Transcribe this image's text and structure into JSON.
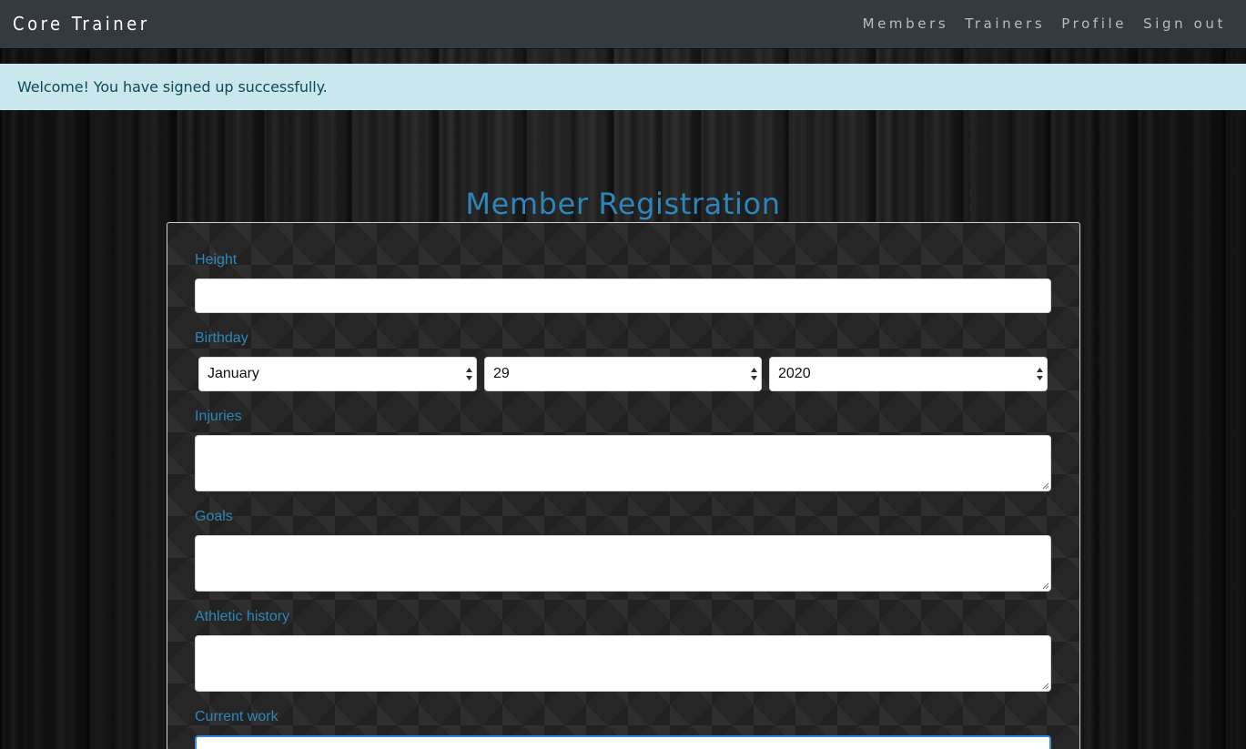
{
  "navbar": {
    "brand": "Core Trainer",
    "links": [
      "Members",
      "Trainers",
      "Profile",
      "Sign out"
    ]
  },
  "alert": {
    "message": "Welcome! You have signed up successfully."
  },
  "page": {
    "title": "Member Registration"
  },
  "form": {
    "height": {
      "label": "Height",
      "value": ""
    },
    "birthday": {
      "label": "Birthday",
      "month": "January",
      "day": "29",
      "year": "2020"
    },
    "injuries": {
      "label": "Injuries",
      "value": ""
    },
    "goals": {
      "label": "Goals",
      "value": ""
    },
    "athletic_history": {
      "label": "Athletic history",
      "value": ""
    },
    "current_work": {
      "label": "Current work",
      "value": ""
    }
  },
  "colors": {
    "accent": "#2e86b8",
    "navbar_bg": "#343a40",
    "alert_bg": "#c9e7ec",
    "alert_text": "#0f4a57",
    "focus_border": "#3f86d6"
  }
}
